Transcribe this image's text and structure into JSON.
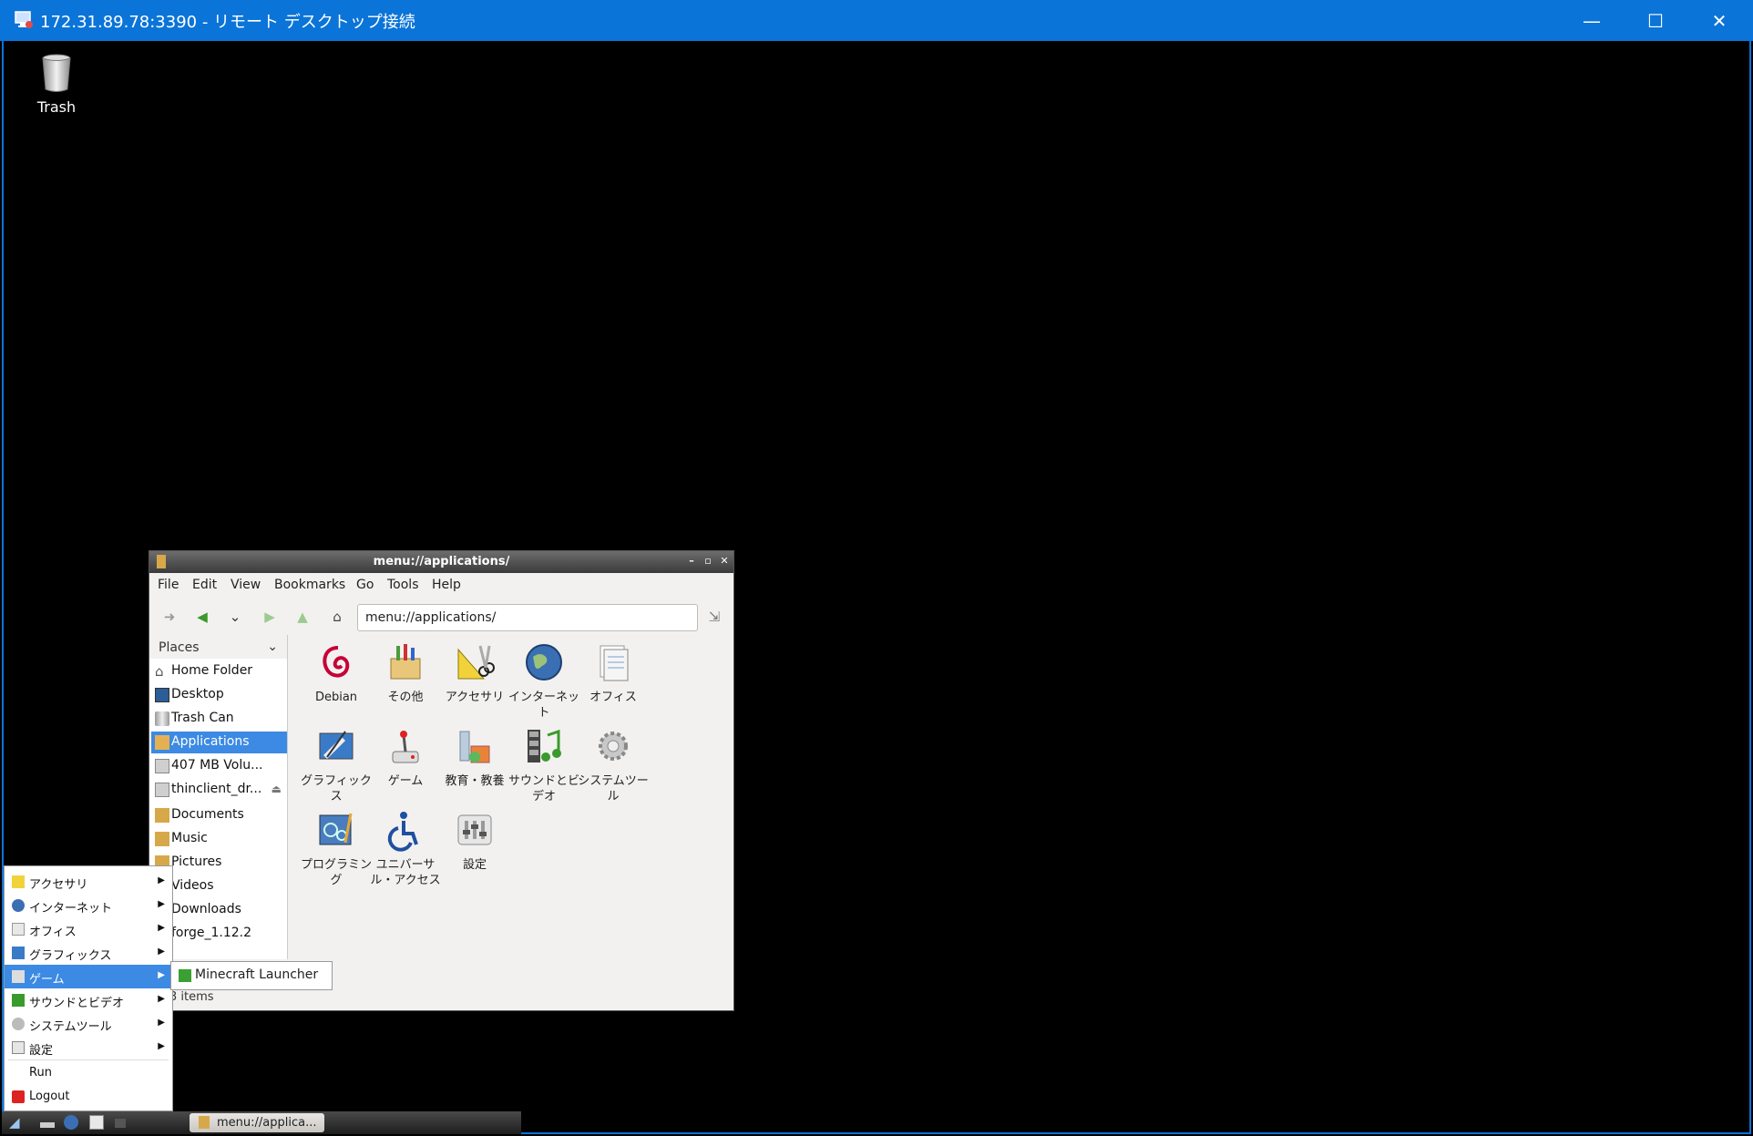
{
  "window": {
    "title": "172.31.89.78:3390 - リモート デスクトップ接続",
    "controls": {
      "minimize": "—",
      "maximize": "☐",
      "close": "✕"
    }
  },
  "desktop": {
    "trash_label": "Trash"
  },
  "file_manager": {
    "title": "menu://applications/",
    "menu": [
      "File",
      "Edit",
      "View",
      "Bookmarks",
      "Go",
      "Tools",
      "Help"
    ],
    "address": "menu://applications/",
    "places_label": "Places",
    "places": [
      {
        "label": "Home Folder",
        "icon": "home-icon"
      },
      {
        "label": "Desktop",
        "icon": "desktop-icon"
      },
      {
        "label": "Trash Can",
        "icon": "trash-icon"
      },
      {
        "label": "Applications",
        "icon": "applications-icon",
        "selected": true
      },
      {
        "label": "407 MB Volu...",
        "icon": "drive-icon"
      },
      {
        "label": "thinclient_dr...",
        "icon": "drive-icon"
      },
      {
        "label": "Documents",
        "icon": "folder-icon"
      },
      {
        "label": "Music",
        "icon": "folder-icon"
      },
      {
        "label": "Pictures",
        "icon": "folder-icon"
      },
      {
        "label": "Videos",
        "icon": "folder-icon"
      },
      {
        "label": "Downloads",
        "icon": "folder-icon"
      },
      {
        "label": "forge_1.12.2",
        "icon": "folder-icon"
      }
    ],
    "apps": [
      {
        "label": "Debian",
        "icon": "debian-icon"
      },
      {
        "label": "その他",
        "icon": "other-icon"
      },
      {
        "label": "アクセサリ",
        "icon": "accessories-icon"
      },
      {
        "label": "インターネット",
        "icon": "internet-icon"
      },
      {
        "label": "オフィス",
        "icon": "office-icon"
      },
      {
        "label": "グラフィックス",
        "icon": "graphics-icon"
      },
      {
        "label": "ゲーム",
        "icon": "games-icon"
      },
      {
        "label": "教育・教養",
        "icon": "education-icon"
      },
      {
        "label": "サウンドとビデオ",
        "icon": "sound-video-icon"
      },
      {
        "label": "システムツール",
        "icon": "system-tools-icon"
      },
      {
        "label": "プログラミング",
        "icon": "programming-icon"
      },
      {
        "label": "ユニバーサル・アクセス",
        "icon": "universal-access-icon"
      },
      {
        "label": "設定",
        "icon": "settings-icon"
      }
    ],
    "status": "3 items"
  },
  "start_menu": {
    "items": [
      {
        "label": "アクセサリ",
        "submenu": true
      },
      {
        "label": "インターネット",
        "submenu": true
      },
      {
        "label": "オフィス",
        "submenu": true
      },
      {
        "label": "グラフィックス",
        "submenu": true
      },
      {
        "label": "ゲーム",
        "submenu": true,
        "selected": true
      },
      {
        "label": "サウンドとビデオ",
        "submenu": true
      },
      {
        "label": "システムツール",
        "submenu": true
      },
      {
        "label": "設定",
        "submenu": true
      },
      {
        "label": "Run",
        "submenu": false
      },
      {
        "label": "Logout",
        "submenu": false
      }
    ],
    "submenu_item": "Minecraft Launcher"
  },
  "taskbar": {
    "task_label": "menu://applica..."
  },
  "colors": {
    "rdp_titlebar": "#0b74d8",
    "selection": "#3c8ae3"
  }
}
